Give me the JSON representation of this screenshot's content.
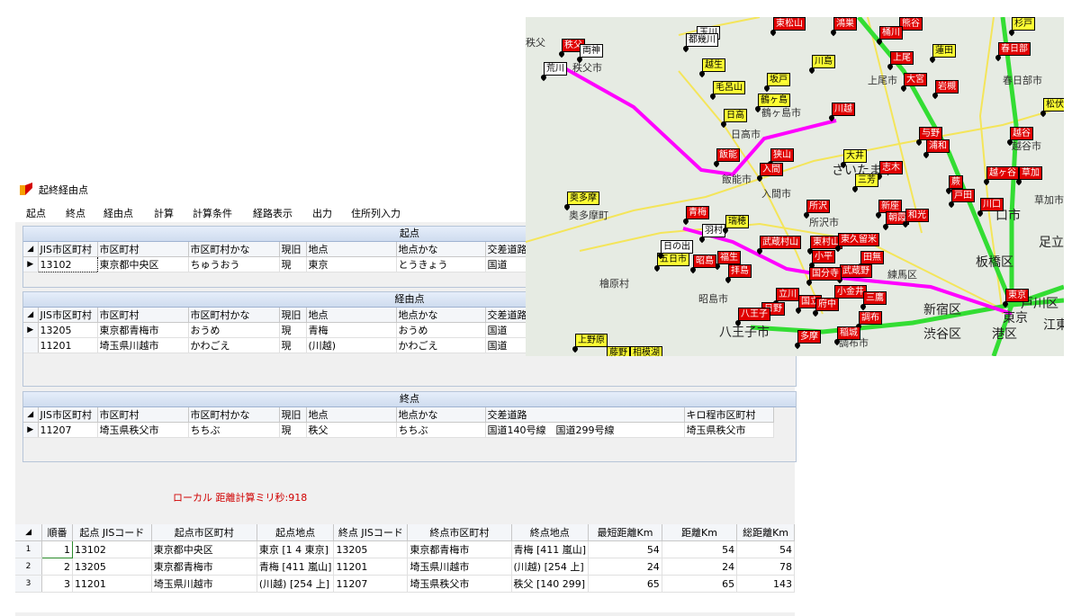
{
  "window": {
    "title": "起終経由点"
  },
  "menu": [
    "起点",
    "終点",
    "経由点",
    "計算",
    "計算条件",
    "経路表示",
    "出力",
    "住所列入力"
  ],
  "columns": [
    "JIS市区町村",
    "市区町村",
    "市区町村かな",
    "現旧",
    "地点",
    "地点かな",
    "交差道路",
    "キロ程市区町村"
  ],
  "start": {
    "header": "起点",
    "rows": [
      {
        "jis": "13102",
        "city": "東京都中央区",
        "kana": "ちゅうおう",
        "gen": "現",
        "point": "東京",
        "pointkana": "とうきょう",
        "road": "国道",
        "kcity": ""
      }
    ]
  },
  "via": {
    "header": "経由点",
    "rows": [
      {
        "jis": "13205",
        "city": "東京都青梅市",
        "kana": "おうめ",
        "gen": "現",
        "point": "青梅",
        "pointkana": "おうめ",
        "road": "国道",
        "kcity": ""
      },
      {
        "jis": "11201",
        "city": "埼玉県川越市",
        "kana": "かわごえ",
        "gen": "現",
        "point": "(川越)",
        "pointkana": "かわごえ",
        "road": "国道",
        "kcity": ""
      }
    ]
  },
  "end": {
    "header": "終点",
    "rows": [
      {
        "jis": "11207",
        "city": "埼玉県秩父市",
        "kana": "ちちぶ",
        "gen": "現",
        "point": "秩父",
        "pointkana": "ちちぶ",
        "road": "国道140号線　国道299号線",
        "kcity": "埼玉県秩父市"
      }
    ]
  },
  "status": "ローカル 距離計算ミリ秒:918",
  "result": {
    "columns": [
      "順番",
      "起点 JISコード",
      "起点市区町村",
      "起点地点",
      "終点 JISコード",
      "終点市区町村",
      "終点地点",
      "最短距離Km",
      "距離Km",
      "総距離Km"
    ],
    "rows": [
      {
        "rn": "1",
        "order": "1",
        "sjis": "13102",
        "scity": "東京都中央区",
        "spoint": "東京 [1 4 東京]",
        "ejis": "13205",
        "ecity": "東京都青梅市",
        "epoint": "青梅 [411 嵐山]",
        "min": "54",
        "dist": "54",
        "total": "54"
      },
      {
        "rn": "2",
        "order": "2",
        "sjis": "13205",
        "scity": "東京都青梅市",
        "spoint": "青梅 [411 嵐山]",
        "ejis": "11201",
        "ecity": "埼玉県川越市",
        "epoint": "(川越) [254 上]",
        "min": "24",
        "dist": "24",
        "total": "78"
      },
      {
        "rn": "3",
        "order": "3",
        "sjis": "11201",
        "scity": "埼玉県川越市",
        "spoint": "(川越) [254 上]",
        "ejis": "11207",
        "ecity": "埼玉県秩父市",
        "epoint": "秩父 [140 299]",
        "min": "65",
        "dist": "65",
        "total": "143"
      }
    ]
  },
  "map": {
    "labels": [
      "上尾市",
      "春日部市",
      "越谷市",
      "草加市",
      "足立",
      "板橋区",
      "新宿区",
      "渋谷区",
      "港区",
      "江東",
      "戸川区",
      "東京",
      "日高市",
      "鶴ヶ島市",
      "飯能市",
      "入間市",
      "所沢市",
      "奥多摩町",
      "檜原村",
      "昭島市",
      "八王子市",
      "調布市",
      "練馬区",
      "秩父市",
      "口市",
      "さいたま市"
    ],
    "markers_red": [
      "秩父",
      "川越",
      "上尾",
      "大宮",
      "岩槻",
      "春日部",
      "越谷",
      "与野",
      "浦和",
      "草加",
      "越ヶ谷",
      "蕨",
      "戸田",
      "川口",
      "飯能",
      "狭山",
      "入間",
      "青梅",
      "羽村",
      "福生",
      "昭島",
      "拝島",
      "所沢",
      "新座",
      "志木",
      "朝霞",
      "和光",
      "武蔵村山",
      "東村山",
      "東久留米",
      "小平",
      "田無",
      "武蔵野",
      "国分寺",
      "小金井",
      "立川",
      "国立",
      "府中",
      "三鷹",
      "調布",
      "日野",
      "八王子",
      "多摩",
      "稲城",
      "東京",
      "熊谷",
      "桶川",
      "東松山",
      "鴻巣",
      "杉戸"
    ],
    "markers_yellow": [
      "川島",
      "越生",
      "毛呂山",
      "坂戸",
      "鶴ヶ島",
      "日高",
      "大井",
      "三芳",
      "瑞穂",
      "五日市",
      "奥多摩",
      "上野原",
      "相模湖",
      "藤野",
      "蓮田",
      "松伏",
      "玉川"
    ],
    "markers_white": [
      "荒川",
      "両神",
      "都幾川",
      "日の出",
      "秩父"
    ]
  },
  "colors": {
    "route": "#ff00ff",
    "road_green": "#33dd33",
    "road_yellow": "#f4e55a",
    "marker_red": "#e00000",
    "marker_yellow": "#ffff33"
  }
}
